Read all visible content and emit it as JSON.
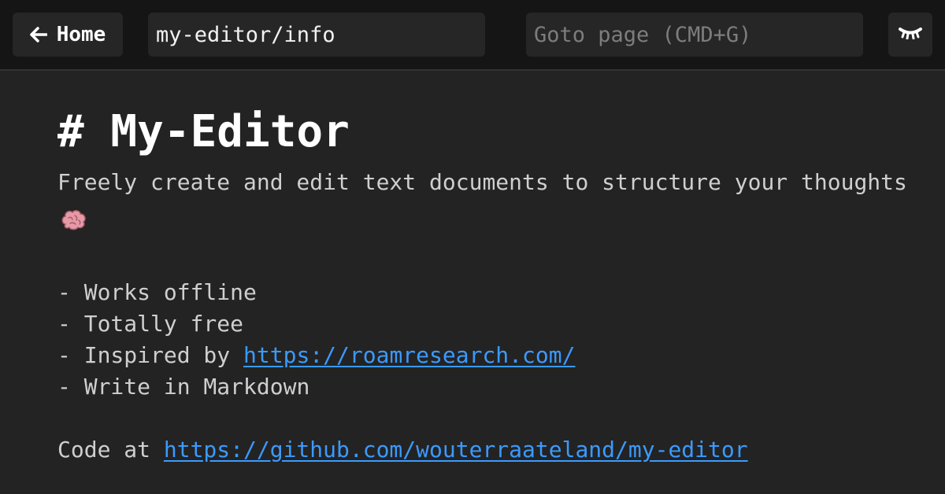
{
  "header": {
    "home_label": "Home",
    "path_value": "my-editor/info",
    "goto_placeholder": "Goto page (CMD+G)"
  },
  "document": {
    "title": "# My-Editor",
    "description": "Freely create and edit text documents to structure your thoughts",
    "list_items": [
      {
        "prefix": "- ",
        "text": "Works offline"
      },
      {
        "prefix": "- ",
        "text": "Totally free"
      },
      {
        "prefix": "- ",
        "text": "Inspired by ",
        "link": "https://roamresearch.com/"
      },
      {
        "prefix": "- ",
        "text": "Write in Markdown"
      }
    ],
    "code_prefix": "Code at ",
    "code_link": "https://github.com/wouterraateland/my-editor"
  },
  "colors": {
    "background": "#232323",
    "topbar": "#151515",
    "control": "#262626",
    "link": "#3b9aff",
    "text": "#cfcfcf"
  },
  "icons": {
    "home": "arrow-left-icon",
    "visibility": "eye-closed-icon",
    "thought": "brain-emoji"
  }
}
